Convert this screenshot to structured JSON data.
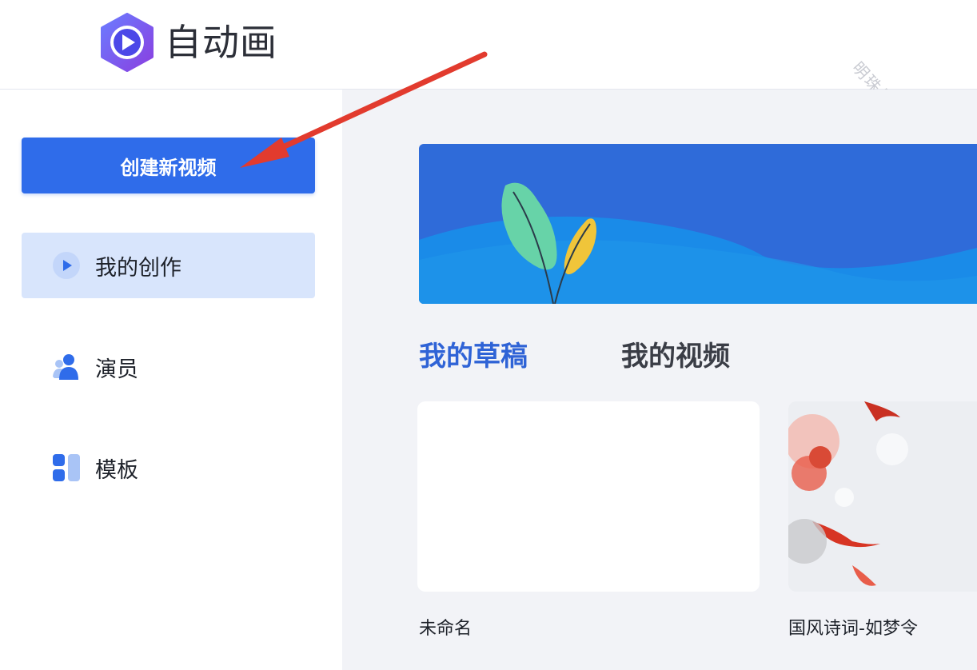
{
  "header": {
    "app_name": "自动画",
    "logo_icon": "play-logo-icon",
    "watermark": "明珠号"
  },
  "sidebar": {
    "create_button": "创建新视频",
    "items": [
      {
        "label": "我的创作",
        "icon": "play-circle-icon",
        "active": true
      },
      {
        "label": "演员",
        "icon": "user-icon",
        "active": false
      },
      {
        "label": "模板",
        "icon": "template-grid-icon",
        "active": false
      }
    ]
  },
  "main": {
    "tabs": [
      {
        "label": "我的草稿",
        "active": true
      },
      {
        "label": "我的视频",
        "active": false
      }
    ],
    "cards": [
      {
        "title": "未命名"
      },
      {
        "title": "国风诗词-如梦令"
      }
    ]
  },
  "colors": {
    "accent": "#2f6cea",
    "active_nav_bg": "#d8e5fc",
    "main_bg": "#f2f3f7",
    "annotation_arrow": "#e23b2e"
  }
}
